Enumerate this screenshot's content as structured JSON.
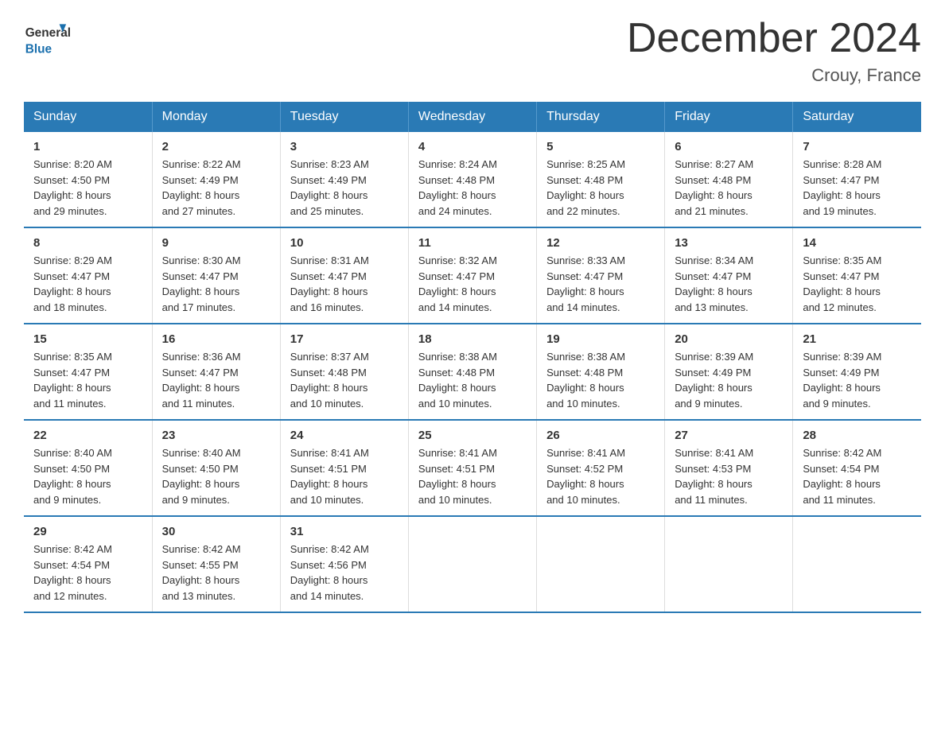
{
  "header": {
    "logo_general": "General",
    "logo_blue": "Blue",
    "month_title": "December 2024",
    "location": "Crouy, France"
  },
  "weekdays": [
    "Sunday",
    "Monday",
    "Tuesday",
    "Wednesday",
    "Thursday",
    "Friday",
    "Saturday"
  ],
  "weeks": [
    [
      {
        "day": "1",
        "sunrise": "8:20 AM",
        "sunset": "4:50 PM",
        "daylight": "8 hours and 29 minutes."
      },
      {
        "day": "2",
        "sunrise": "8:22 AM",
        "sunset": "4:49 PM",
        "daylight": "8 hours and 27 minutes."
      },
      {
        "day": "3",
        "sunrise": "8:23 AM",
        "sunset": "4:49 PM",
        "daylight": "8 hours and 25 minutes."
      },
      {
        "day": "4",
        "sunrise": "8:24 AM",
        "sunset": "4:48 PM",
        "daylight": "8 hours and 24 minutes."
      },
      {
        "day": "5",
        "sunrise": "8:25 AM",
        "sunset": "4:48 PM",
        "daylight": "8 hours and 22 minutes."
      },
      {
        "day": "6",
        "sunrise": "8:27 AM",
        "sunset": "4:48 PM",
        "daylight": "8 hours and 21 minutes."
      },
      {
        "day": "7",
        "sunrise": "8:28 AM",
        "sunset": "4:47 PM",
        "daylight": "8 hours and 19 minutes."
      }
    ],
    [
      {
        "day": "8",
        "sunrise": "8:29 AM",
        "sunset": "4:47 PM",
        "daylight": "8 hours and 18 minutes."
      },
      {
        "day": "9",
        "sunrise": "8:30 AM",
        "sunset": "4:47 PM",
        "daylight": "8 hours and 17 minutes."
      },
      {
        "day": "10",
        "sunrise": "8:31 AM",
        "sunset": "4:47 PM",
        "daylight": "8 hours and 16 minutes."
      },
      {
        "day": "11",
        "sunrise": "8:32 AM",
        "sunset": "4:47 PM",
        "daylight": "8 hours and 14 minutes."
      },
      {
        "day": "12",
        "sunrise": "8:33 AM",
        "sunset": "4:47 PM",
        "daylight": "8 hours and 14 minutes."
      },
      {
        "day": "13",
        "sunrise": "8:34 AM",
        "sunset": "4:47 PM",
        "daylight": "8 hours and 13 minutes."
      },
      {
        "day": "14",
        "sunrise": "8:35 AM",
        "sunset": "4:47 PM",
        "daylight": "8 hours and 12 minutes."
      }
    ],
    [
      {
        "day": "15",
        "sunrise": "8:35 AM",
        "sunset": "4:47 PM",
        "daylight": "8 hours and 11 minutes."
      },
      {
        "day": "16",
        "sunrise": "8:36 AM",
        "sunset": "4:47 PM",
        "daylight": "8 hours and 11 minutes."
      },
      {
        "day": "17",
        "sunrise": "8:37 AM",
        "sunset": "4:48 PM",
        "daylight": "8 hours and 10 minutes."
      },
      {
        "day": "18",
        "sunrise": "8:38 AM",
        "sunset": "4:48 PM",
        "daylight": "8 hours and 10 minutes."
      },
      {
        "day": "19",
        "sunrise": "8:38 AM",
        "sunset": "4:48 PM",
        "daylight": "8 hours and 10 minutes."
      },
      {
        "day": "20",
        "sunrise": "8:39 AM",
        "sunset": "4:49 PM",
        "daylight": "8 hours and 9 minutes."
      },
      {
        "day": "21",
        "sunrise": "8:39 AM",
        "sunset": "4:49 PM",
        "daylight": "8 hours and 9 minutes."
      }
    ],
    [
      {
        "day": "22",
        "sunrise": "8:40 AM",
        "sunset": "4:50 PM",
        "daylight": "8 hours and 9 minutes."
      },
      {
        "day": "23",
        "sunrise": "8:40 AM",
        "sunset": "4:50 PM",
        "daylight": "8 hours and 9 minutes."
      },
      {
        "day": "24",
        "sunrise": "8:41 AM",
        "sunset": "4:51 PM",
        "daylight": "8 hours and 10 minutes."
      },
      {
        "day": "25",
        "sunrise": "8:41 AM",
        "sunset": "4:51 PM",
        "daylight": "8 hours and 10 minutes."
      },
      {
        "day": "26",
        "sunrise": "8:41 AM",
        "sunset": "4:52 PM",
        "daylight": "8 hours and 10 minutes."
      },
      {
        "day": "27",
        "sunrise": "8:41 AM",
        "sunset": "4:53 PM",
        "daylight": "8 hours and 11 minutes."
      },
      {
        "day": "28",
        "sunrise": "8:42 AM",
        "sunset": "4:54 PM",
        "daylight": "8 hours and 11 minutes."
      }
    ],
    [
      {
        "day": "29",
        "sunrise": "8:42 AM",
        "sunset": "4:54 PM",
        "daylight": "8 hours and 12 minutes."
      },
      {
        "day": "30",
        "sunrise": "8:42 AM",
        "sunset": "4:55 PM",
        "daylight": "8 hours and 13 minutes."
      },
      {
        "day": "31",
        "sunrise": "8:42 AM",
        "sunset": "4:56 PM",
        "daylight": "8 hours and 14 minutes."
      },
      null,
      null,
      null,
      null
    ]
  ],
  "labels": {
    "sunrise": "Sunrise:",
    "sunset": "Sunset:",
    "daylight": "Daylight:"
  }
}
